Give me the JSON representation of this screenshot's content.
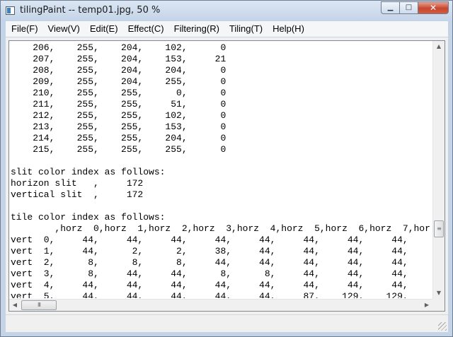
{
  "window": {
    "title": "tilingPaint -- temp01.jpg, 50 %",
    "minimize_glyph": "▁",
    "maximize_glyph": "□",
    "close_glyph": "✕"
  },
  "menu": [
    {
      "label": "File(F)"
    },
    {
      "label": "View(V)"
    },
    {
      "label": "Edit(E)"
    },
    {
      "label": "Effect(C)"
    },
    {
      "label": "Filtering(R)"
    },
    {
      "label": "Tiling(T)"
    },
    {
      "label": "Help(H)"
    }
  ],
  "editor": {
    "lines": [
      "    206,    255,    204,    102,      0",
      "    207,    255,    204,    153,     21",
      "    208,    255,    204,    204,      0",
      "    209,    255,    204,    255,      0",
      "    210,    255,    255,      0,      0",
      "    211,    255,    255,     51,      0",
      "    212,    255,    255,    102,      0",
      "    213,    255,    255,    153,      0",
      "    214,    255,    255,    204,      0",
      "    215,    255,    255,    255,      0",
      "",
      "slit color index as follows:",
      "horizon slit   ,     172",
      "vertical slit  ,     172",
      "",
      "tile color index as follows:",
      "        ,horz  0,horz  1,horz  2,horz  3,horz  4,horz  5,horz  6,horz  7,hor",
      "vert  0,     44,     44,     44,     44,     44,     44,     44,     44,",
      "vert  1,     44,      2,      2,     38,     44,     44,     44,     44,",
      "vert  2,      8,      8,      8,     44,     44,     44,     44,     44,",
      "vert  3,      8,     44,     44,      8,      8,     44,     44,     44,",
      "vert  4,     44,     44,     44,     44,     44,     44,     44,     44,",
      "vert  5,     44,     44,     44,     44,     44,     87,    129,    129,"
    ]
  },
  "scrollbars": {
    "up_glyph": "▲",
    "down_glyph": "▼",
    "left_glyph": "◀",
    "right_glyph": "▶",
    "v_grip": "≡",
    "h_grip": "III"
  },
  "colors": {
    "frame": "#c4d3e6",
    "close_button": "#c7472f",
    "menubar": "#f5f6f7",
    "editor_bg": "#ffffff"
  }
}
